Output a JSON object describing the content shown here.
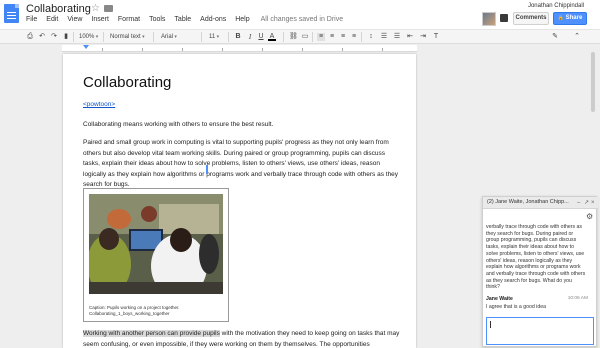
{
  "header": {
    "title": "Collaborating",
    "menus": [
      "File",
      "Edit",
      "View",
      "Insert",
      "Format",
      "Tools",
      "Table",
      "Add-ons",
      "Help"
    ],
    "saved_status": "All changes saved in Drive",
    "user_name": "Jonathan Chippindall",
    "comments_label": "Comments",
    "share_label": "Share"
  },
  "toolbar": {
    "zoom": "100%",
    "style": "Normal text",
    "font": "Arial",
    "size": "11"
  },
  "doc": {
    "heading": "Collaborating",
    "link": "<powtoon>",
    "p1": "Collaborating means working with others to ensure the best result.",
    "p2": "Paired and small group work in computing is vital to supporting pupils' progress as they not only learn from others but also develop vital team working skills. During paired or group programming, pupils can discuss tasks, explain their ideas about how to solve problems, listen to others' views, use others' ideas, reason logically as they explain how algorithms or programs work and verbally trace through code with others as they search for bugs.",
    "caption_line1": "Caption: Pupils working on a project together.",
    "caption_line2": "Collaborating_1_boys_working_together",
    "p3_selected": "Working with another person can provide pupils",
    "p3_rest": " with the motivation they need to keep going on tasks that may seem confusing, or even impossible, if they were working on them by themselves. The opportunities"
  },
  "comment_panel": {
    "title": "(2) Jane Waite, Jonathan Chipp...",
    "thread_text": "verbally trace through code with others as they search for bugs. During paired or group programming, pupils can discuss tasks, explain their ideas about how to solve problems, listen to others' views, use others' ideas, reason logically as they explain how algorithms or programs work and verbally trace through code with others as they search for bugs. What do you think?",
    "reply_author": "Jane Waite",
    "reply_time": "10:06 AM",
    "reply_body": "I agree that is a good idea"
  }
}
